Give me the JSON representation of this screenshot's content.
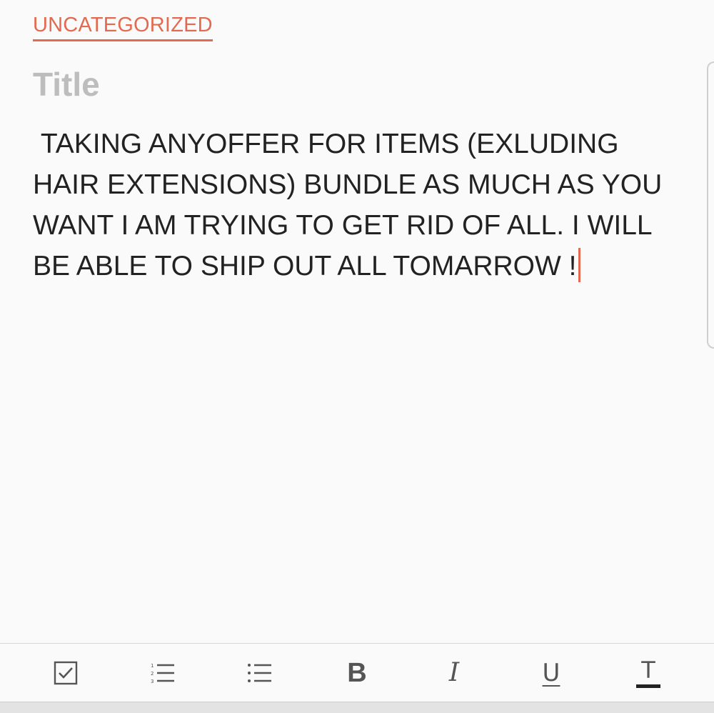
{
  "note": {
    "category": "UNCATEGORIZED",
    "title_placeholder": "Title",
    "title_value": "",
    "body": " TAKING ANYOFFER FOR ITEMS (EXLUDING HAIR EXTENSIONS) BUNDLE AS MUCH AS YOU WANT I AM TRYING TO GET RID OF ALL. I WILL BE ABLE TO SHIP OUT ALL TOMARROW !"
  },
  "toolbar": {
    "tools": [
      {
        "icon": "checkbox-icon"
      },
      {
        "icon": "numbered-list-icon"
      },
      {
        "icon": "bulleted-list-icon"
      },
      {
        "icon": "bold-icon",
        "label": "B"
      },
      {
        "icon": "italic-icon",
        "label": "I"
      },
      {
        "icon": "underline-icon",
        "label": "U"
      },
      {
        "icon": "text-style-icon",
        "label": "T"
      }
    ]
  },
  "colors": {
    "accent": "#e26a50",
    "text": "#222222",
    "placeholder": "#bdbdbd",
    "background": "#fafafa"
  }
}
